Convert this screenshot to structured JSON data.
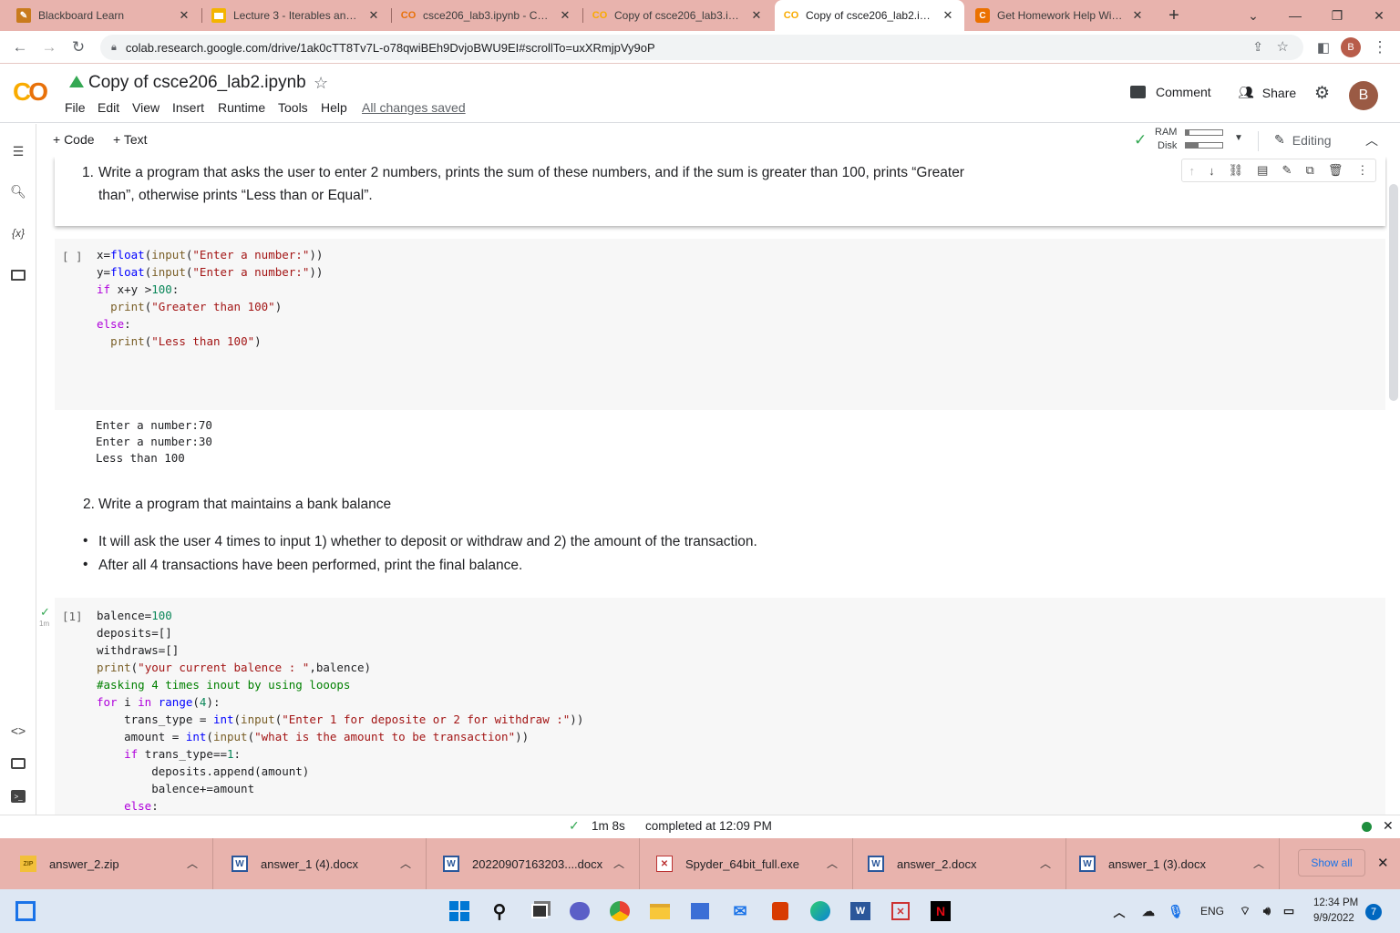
{
  "browser": {
    "tabs": [
      {
        "label": "Blackboard Learn",
        "icon": "blackboard-icon",
        "active": false
      },
      {
        "label": "Lecture 3 - Iterables and loo",
        "icon": "slides-icon",
        "active": false
      },
      {
        "label": "csce206_lab3.ipynb - Colab",
        "icon": "colab-icon",
        "active": false
      },
      {
        "label": "Copy of csce206_lab3.ipynb",
        "icon": "colab-icon",
        "active": false
      },
      {
        "label": "Copy of csce206_lab2.ipynb",
        "icon": "colab-icon",
        "active": true
      },
      {
        "label": "Get Homework Help With C",
        "icon": "chegg-icon",
        "active": false
      }
    ],
    "new_tab": "+",
    "url": "colab.research.google.com/drive/1ak0cTT8Tv7L-o78qwiBEh9DvjoBWU9EI#scrollTo=uxXRmjpVy9oP",
    "profile_initial": "B"
  },
  "colab": {
    "logo": "CO",
    "title": "Copy of csce206_lab2.ipynb",
    "menu": [
      "File",
      "Edit",
      "View",
      "Insert",
      "Runtime",
      "Tools",
      "Help"
    ],
    "saved_status": "All changes saved",
    "comment": "Comment",
    "share": "Share",
    "avatar": "B",
    "toolbar": {
      "code": "+ Code",
      "text": "+ Text",
      "ram": "RAM",
      "disk": "Disk",
      "editing": "Editing"
    }
  },
  "notebook": {
    "q1_number": "1.",
    "q1_line1": "Write a program that asks the user to enter 2 numbers, prints the sum of these numbers, and if the sum is greater than 100, prints “Greater",
    "q1_line2": "than”, otherwise prints “Less than or Equal”.",
    "cell1_prompt": "[ ]",
    "cell1_output": [
      "Enter a number:70",
      "Enter a number:30",
      "Less than 100"
    ],
    "q2_number": "2.",
    "q2_title": "Write a program that maintains a bank balance",
    "q2_bullets": [
      "It will ask the user 4 times to input 1) whether to deposit or withdraw and 2) the amount of the transaction.",
      "After all 4 transactions have been performed, print the final balance."
    ],
    "cell2_prompt": "[1]",
    "cell2_time": "1m"
  },
  "status": {
    "duration": "1m 8s",
    "completed": "completed at 12:09 PM"
  },
  "downloads": {
    "items": [
      {
        "name": "answer_2.zip",
        "icon": "zip-icon"
      },
      {
        "name": "answer_1 (4).docx",
        "icon": "word-icon"
      },
      {
        "name": "20220907163203....docx",
        "icon": "word-icon"
      },
      {
        "name": "Spyder_64bit_full.exe",
        "icon": "exe-icon"
      },
      {
        "name": "answer_2.docx",
        "icon": "word-icon"
      },
      {
        "name": "answer_1 (3).docx",
        "icon": "word-icon"
      }
    ],
    "show_all": "Show all"
  },
  "taskbar": {
    "lang": "ENG",
    "time": "12:34 PM",
    "date": "9/9/2022",
    "notifications": "7"
  }
}
